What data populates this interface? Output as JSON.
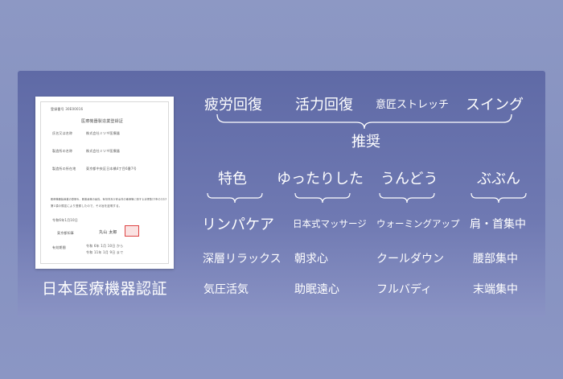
{
  "certificate": {
    "number": "登録番号 30E00016",
    "title": "医療機器製造業登録証",
    "rows": [
      {
        "label": "氏名又は名称",
        "value": "株式会社ミツギ医療器"
      },
      {
        "label": "製造所の名称",
        "value": "株式会社ミツギ医療器"
      },
      {
        "label": "製造所の所在地",
        "value": "東京都中央区日本橋4丁目6番7号"
      }
    ],
    "body_line1": "医療機器製造業の登録を、医薬品等の品質、有効性及び安全性の確保等に関する法律第23条の2の3",
    "body_line2": "第1項の規定により登録したので、その旨を証明する。",
    "issue_date": "令和6年1月10日",
    "issuer": "東京都知事",
    "issuer_name": "丸山 太郎",
    "period_label": "有効期間",
    "period_from": "令和 6年 1月 10日 から",
    "period_to": "令和 11年 1月 9日 まで",
    "caption": "日本医療機器認証"
  },
  "top_features": [
    "疲労回復",
    "活力回復",
    "意匠ストレッチ",
    "スイング"
  ],
  "recommend_label": "推奨",
  "columns": [
    {
      "header": "特色",
      "items": [
        "リンパケア",
        "深層リラックス",
        "気圧活気"
      ]
    },
    {
      "header": "ゆったりした",
      "items": [
        "日本式マッサージ",
        "朝求心",
        "助眠遠心"
      ]
    },
    {
      "header": "うんどう",
      "items": [
        "ウォーミングアップ",
        "クールダウン",
        "フルバディ"
      ]
    },
    {
      "header": "ぶぶん",
      "items": [
        "肩・首集中",
        "腰部集中",
        "末端集中"
      ]
    }
  ],
  "colors": {
    "background": "#8b96c4",
    "panel": "#6570ab",
    "text": "#ffffff"
  }
}
